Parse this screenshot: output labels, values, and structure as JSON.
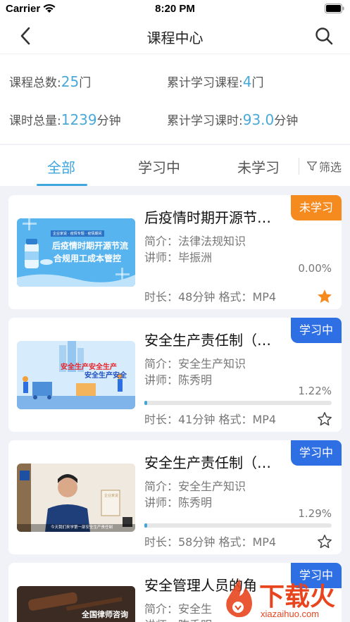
{
  "status_bar": {
    "carrier": "Carrier",
    "time": "8:20 PM"
  },
  "nav": {
    "title": "课程中心"
  },
  "stats": {
    "total_courses_label": "课程总数:",
    "total_courses_value": "25",
    "total_courses_unit": "门",
    "studied_courses_label": "累计学习课程:",
    "studied_courses_value": "4",
    "studied_courses_unit": "门",
    "total_hours_label": "课时总量:",
    "total_hours_value": "1239",
    "total_hours_unit": "分钟",
    "studied_hours_label": "累计学习课时:",
    "studied_hours_value": "93.0",
    "studied_hours_unit": "分钟"
  },
  "tabs": [
    {
      "label": "全部"
    },
    {
      "label": "学习中"
    },
    {
      "label": "未学习"
    }
  ],
  "filter_label": "筛选",
  "colors": {
    "accent": "#3fa6de",
    "badge_not_started": "#f58a1f",
    "badge_in_progress": "#2f6fe4",
    "star_filled": "#f58a1f"
  },
  "courses": [
    {
      "title": "后疫情时期开源节…",
      "intro": "简介：法律法规知识",
      "teacher": "讲师：毕振洲",
      "progress_text": "0.00%",
      "progress": 0,
      "meta": "时长：48分钟  格式：MP4",
      "badge": "未学习",
      "favorite": true,
      "thumb_text_1": "后疫情时期开源节流",
      "thumb_text_2": "合规用工成本管控",
      "thumb_small": "企业家说 · 疫情专题 · 疫情期间"
    },
    {
      "title": "安全生产责任制（…",
      "intro": "简介：安全生产知识",
      "teacher": "讲师：陈秀明",
      "progress_text": "1.22%",
      "progress": 0.0122,
      "meta": "时长：41分钟  格式：MP4",
      "badge": "学习中",
      "favorite": false,
      "thumb_text_1": "安全生产安全生产",
      "thumb_text_2": "安全生产安全"
    },
    {
      "title": "安全生产责任制（…",
      "intro": "简介：安全生产知识",
      "teacher": "讲师：陈秀明",
      "progress_text": "1.29%",
      "progress": 0.0129,
      "meta": "时长：58分钟  格式：MP4",
      "badge": "学习中",
      "favorite": false,
      "thumb_caption": "今天我们来学第一部安全生产责任制",
      "thumb_sign": "企业家说"
    },
    {
      "title": "安全管理人员的角",
      "intro": "简介：安全生",
      "teacher": "讲师：陈秀明",
      "badge": "学习中",
      "thumb_caption": "全国律师咨询日"
    }
  ],
  "watermark": {
    "text": "下载火",
    "url": "xiazaihuo.com"
  }
}
